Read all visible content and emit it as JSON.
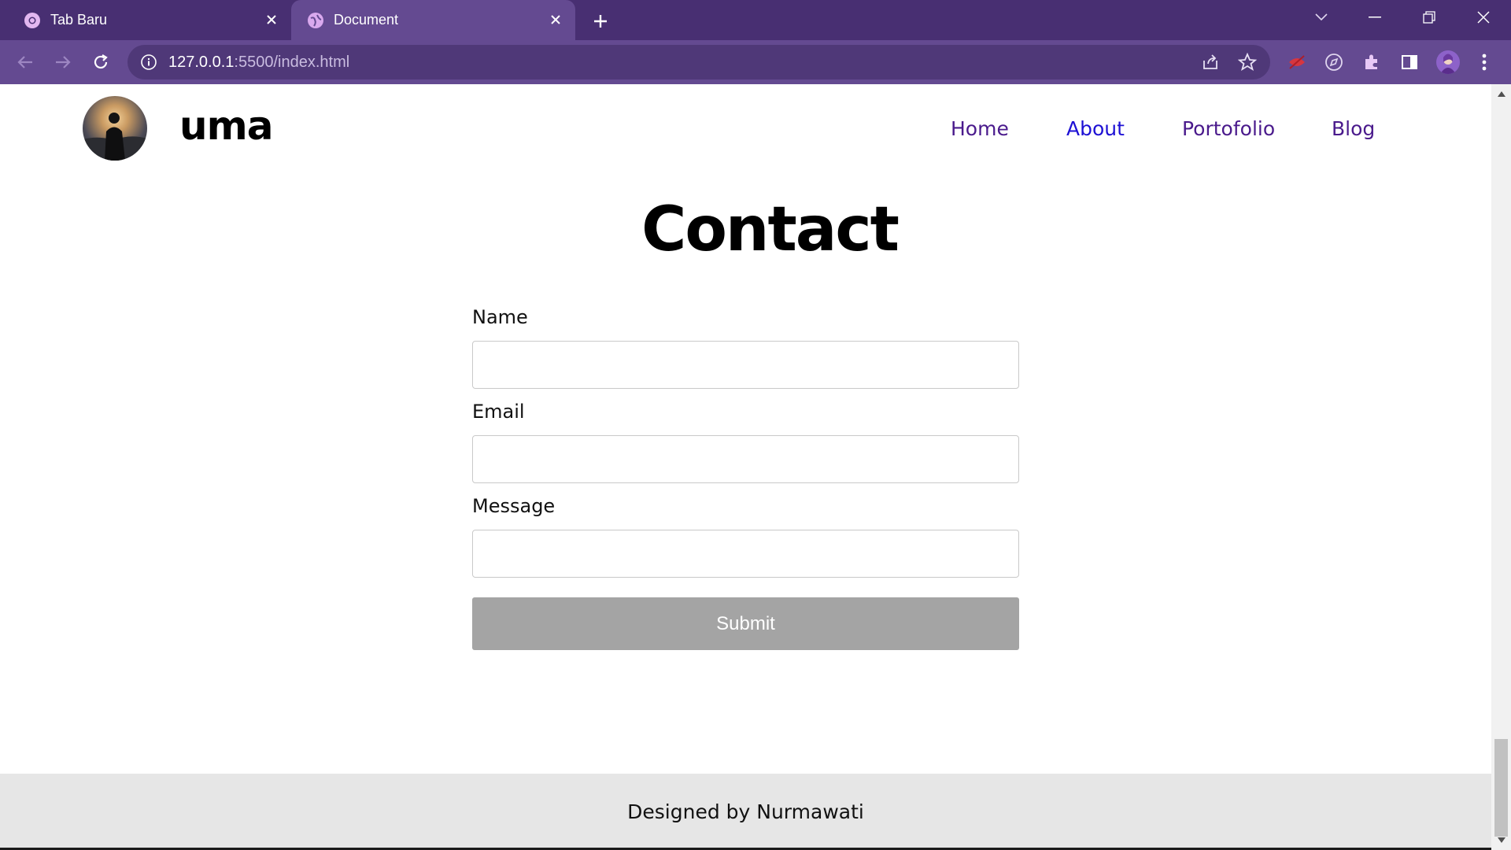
{
  "browser": {
    "tabs": [
      {
        "label": "Tab Baru",
        "active": false
      },
      {
        "label": "Document",
        "active": true
      }
    ],
    "url_host": "127.0.0.1",
    "url_path": ":5500/index.html"
  },
  "site": {
    "brand": "uma",
    "nav": [
      {
        "label": "Home"
      },
      {
        "label": "About"
      },
      {
        "label": "Portofolio"
      },
      {
        "label": "Blog"
      }
    ]
  },
  "contact": {
    "title": "Contact",
    "fields": {
      "name_label": "Name",
      "name_value": "",
      "email_label": "Email",
      "email_value": "",
      "message_label": "Message",
      "message_value": ""
    },
    "submit_label": "Submit"
  },
  "footer": {
    "text": "Designed by Nurmawati"
  },
  "colors": {
    "tabbar": "#482f72",
    "toolbar": "#644a91",
    "nav_link": "#4a1a8c",
    "nav_active": "#1d10d4",
    "submit_bg": "#a4a4a4",
    "footer_bg": "#e6e6e6"
  }
}
